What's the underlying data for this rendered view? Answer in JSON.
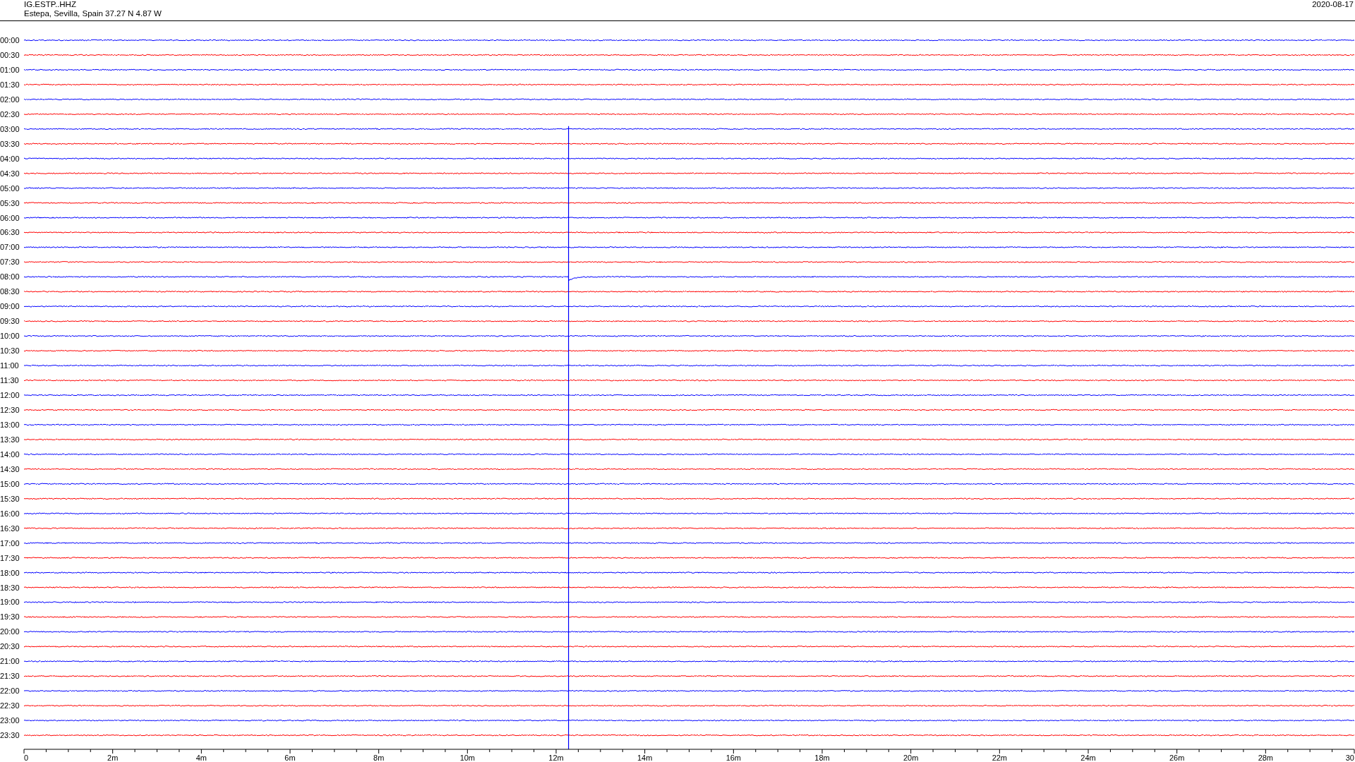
{
  "header": {
    "station": "IG.ESTP..HHZ",
    "location": "Estepa, Sevilla, Spain  37.27 N 4.87 W",
    "date": "2020-08-17"
  },
  "rows": [
    {
      "label": "00:00",
      "color": "#0000ff"
    },
    {
      "label": "00:30",
      "color": "#ff0000"
    },
    {
      "label": "01:00",
      "color": "#0000ff"
    },
    {
      "label": "01:30",
      "color": "#ff0000"
    },
    {
      "label": "02:00",
      "color": "#0000ff"
    },
    {
      "label": "02:30",
      "color": "#ff0000"
    },
    {
      "label": "03:00",
      "color": "#0000ff"
    },
    {
      "label": "03:30",
      "color": "#ff0000"
    },
    {
      "label": "04:00",
      "color": "#0000ff"
    },
    {
      "label": "04:30",
      "color": "#ff0000"
    },
    {
      "label": "05:00",
      "color": "#0000ff"
    },
    {
      "label": "05:30",
      "color": "#ff0000"
    },
    {
      "label": "06:00",
      "color": "#0000ff"
    },
    {
      "label": "06:30",
      "color": "#ff0000"
    },
    {
      "label": "07:00",
      "color": "#0000ff"
    },
    {
      "label": "07:30",
      "color": "#ff0000"
    },
    {
      "label": "08:00",
      "color": "#0000ff"
    },
    {
      "label": "08:30",
      "color": "#ff0000"
    },
    {
      "label": "09:00",
      "color": "#0000ff"
    },
    {
      "label": "09:30",
      "color": "#ff0000"
    },
    {
      "label": "10:00",
      "color": "#0000ff"
    },
    {
      "label": "10:30",
      "color": "#ff0000"
    },
    {
      "label": "11:00",
      "color": "#0000ff"
    },
    {
      "label": "11:30",
      "color": "#ff0000"
    },
    {
      "label": "12:00",
      "color": "#0000ff"
    },
    {
      "label": "12:30",
      "color": "#ff0000"
    },
    {
      "label": "13:00",
      "color": "#0000ff"
    },
    {
      "label": "13:30",
      "color": "#ff0000"
    },
    {
      "label": "14:00",
      "color": "#0000ff"
    },
    {
      "label": "14:30",
      "color": "#ff0000"
    },
    {
      "label": "15:00",
      "color": "#0000ff"
    },
    {
      "label": "15:30",
      "color": "#ff0000"
    },
    {
      "label": "16:00",
      "color": "#0000ff"
    },
    {
      "label": "16:30",
      "color": "#ff0000"
    },
    {
      "label": "17:00",
      "color": "#0000ff"
    },
    {
      "label": "17:30",
      "color": "#ff0000"
    },
    {
      "label": "18:00",
      "color": "#0000ff"
    },
    {
      "label": "18:30",
      "color": "#ff0000"
    },
    {
      "label": "19:00",
      "color": "#0000ff"
    },
    {
      "label": "19:30",
      "color": "#ff0000"
    },
    {
      "label": "20:00",
      "color": "#0000ff"
    },
    {
      "label": "20:30",
      "color": "#ff0000"
    },
    {
      "label": "21:00",
      "color": "#0000ff"
    },
    {
      "label": "21:30",
      "color": "#ff0000"
    },
    {
      "label": "22:00",
      "color": "#0000ff"
    },
    {
      "label": "22:30",
      "color": "#ff0000"
    },
    {
      "label": "23:00",
      "color": "#0000ff"
    },
    {
      "label": "23:30",
      "color": "#ff0000"
    }
  ],
  "axis": {
    "tick_labels": [
      "0",
      "2m",
      "4m",
      "6m",
      "8m",
      "10m",
      "12m",
      "14m",
      "16m",
      "18m",
      "20m",
      "22m",
      "24m",
      "26m",
      "28m",
      "30"
    ]
  }
}
